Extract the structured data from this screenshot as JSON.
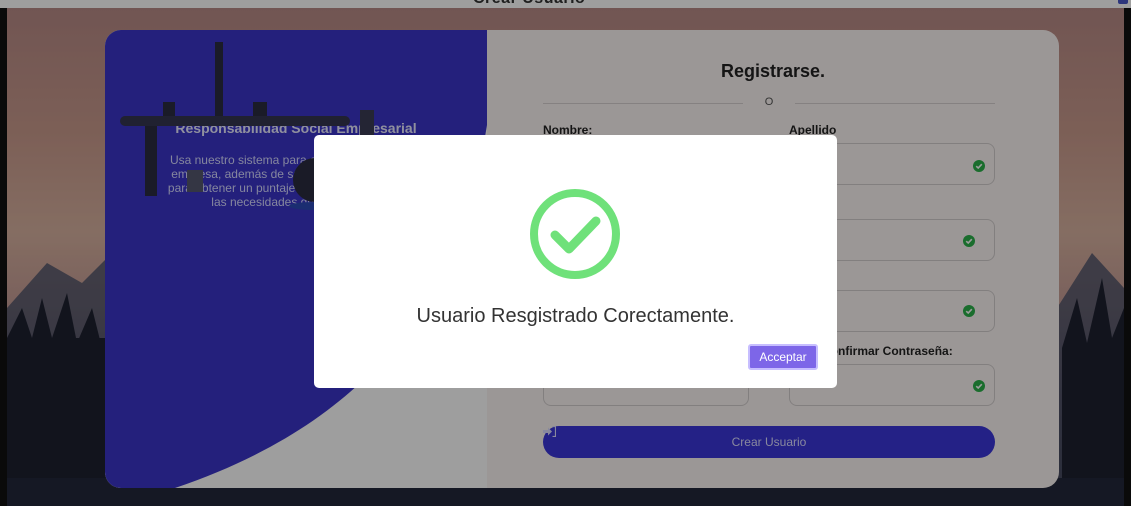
{
  "page": {
    "top_title_clipped": "Crear Usuario"
  },
  "left_panel": {
    "title": "Responsabilidad Social Empresarial",
    "description": "Usa nuestro sistema para calcular el RSE de tu empresa, además de saber qué debes mejorar para obtener un puntaje aceptable de acuerdo a las necesidades de tu empresa."
  },
  "form": {
    "title": "Registrarse.",
    "separator": "O",
    "fields": {
      "nombre": {
        "label": "Nombre:",
        "value": ""
      },
      "apellido": {
        "label": "Apellido",
        "value": ""
      },
      "row2_left": {
        "value": ""
      },
      "row2_right": {
        "value": ""
      },
      "row3_left": {
        "value": ""
      },
      "row3_right": {
        "value": ""
      },
      "password": {
        "value": ""
      },
      "confirm_password": {
        "label": "Confirmar Contraseña:",
        "value": ""
      }
    },
    "submit_label": "Crear Usuario",
    "submit_icon": "sign-in-icon"
  },
  "modal": {
    "icon": "check-circle-icon",
    "message": "Usuario Resgistrado Corectamente.",
    "accept_label": "Acceptar"
  },
  "colors": {
    "primary": "#3b36d8",
    "success": "#6fe17a",
    "accept_button": "#7d66e8",
    "valid_check": "#2bb04a"
  }
}
